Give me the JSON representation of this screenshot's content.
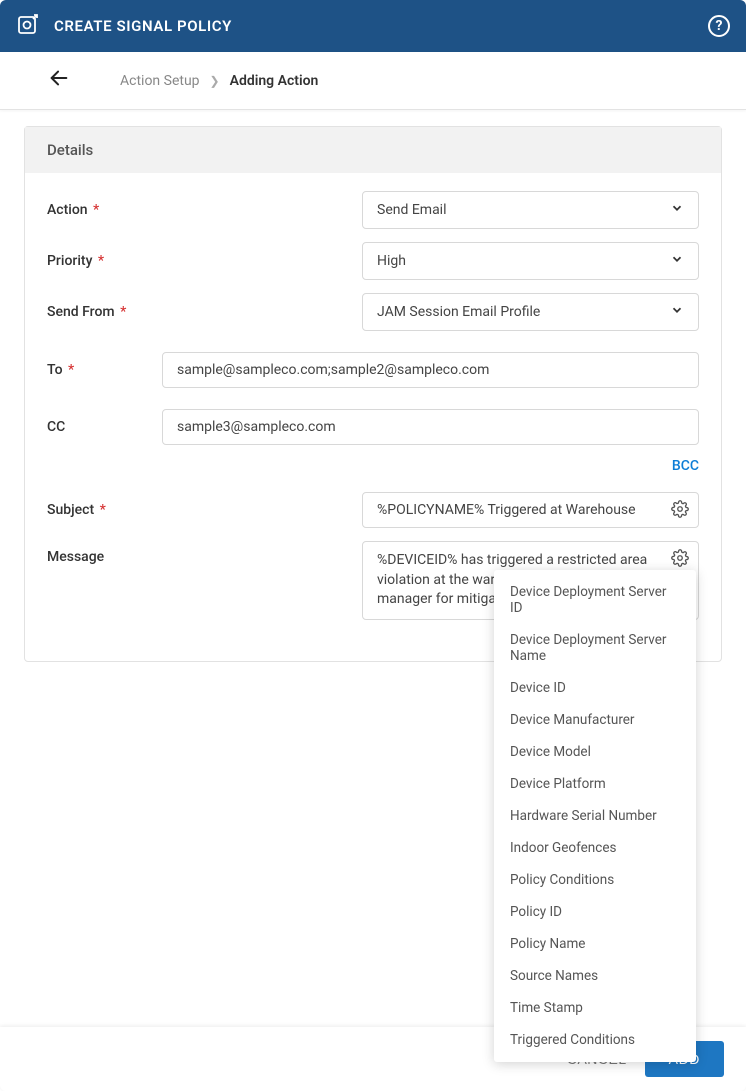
{
  "header": {
    "title": "CREATE SIGNAL POLICY"
  },
  "breadcrumb": {
    "parent": "Action Setup",
    "current": "Adding Action"
  },
  "card": {
    "title": "Details"
  },
  "labels": {
    "action": "Action",
    "priority": "Priority",
    "sendFrom": "Send From",
    "to": "To",
    "cc": "CC",
    "bcc": "BCC",
    "subject": "Subject",
    "message": "Message"
  },
  "values": {
    "action": "Send Email",
    "priority": "High",
    "sendFrom": "JAM Session Email Profile",
    "to": "sample@sampleco.com;sample2@sampleco.com",
    "cc": "sample3@sampleco.com",
    "subject": "%POLICYNAME% Triggered at Warehouse",
    "message": "%DEVICEID% has triggered a restricted area violation at the warehouse. Please notify shift manager for mitigat"
  },
  "dropdown": [
    "Device Deployment Server ID",
    "Device Deployment Server Name",
    "Device ID",
    "Device Manufacturer",
    "Device Model",
    "Device Platform",
    "Hardware Serial Number",
    "Indoor Geofences",
    "Policy Conditions",
    "Policy ID",
    "Policy Name",
    "Source Names",
    "Time Stamp",
    "Triggered Conditions"
  ],
  "footer": {
    "cancel": "CANCEL",
    "add": "ADD"
  }
}
